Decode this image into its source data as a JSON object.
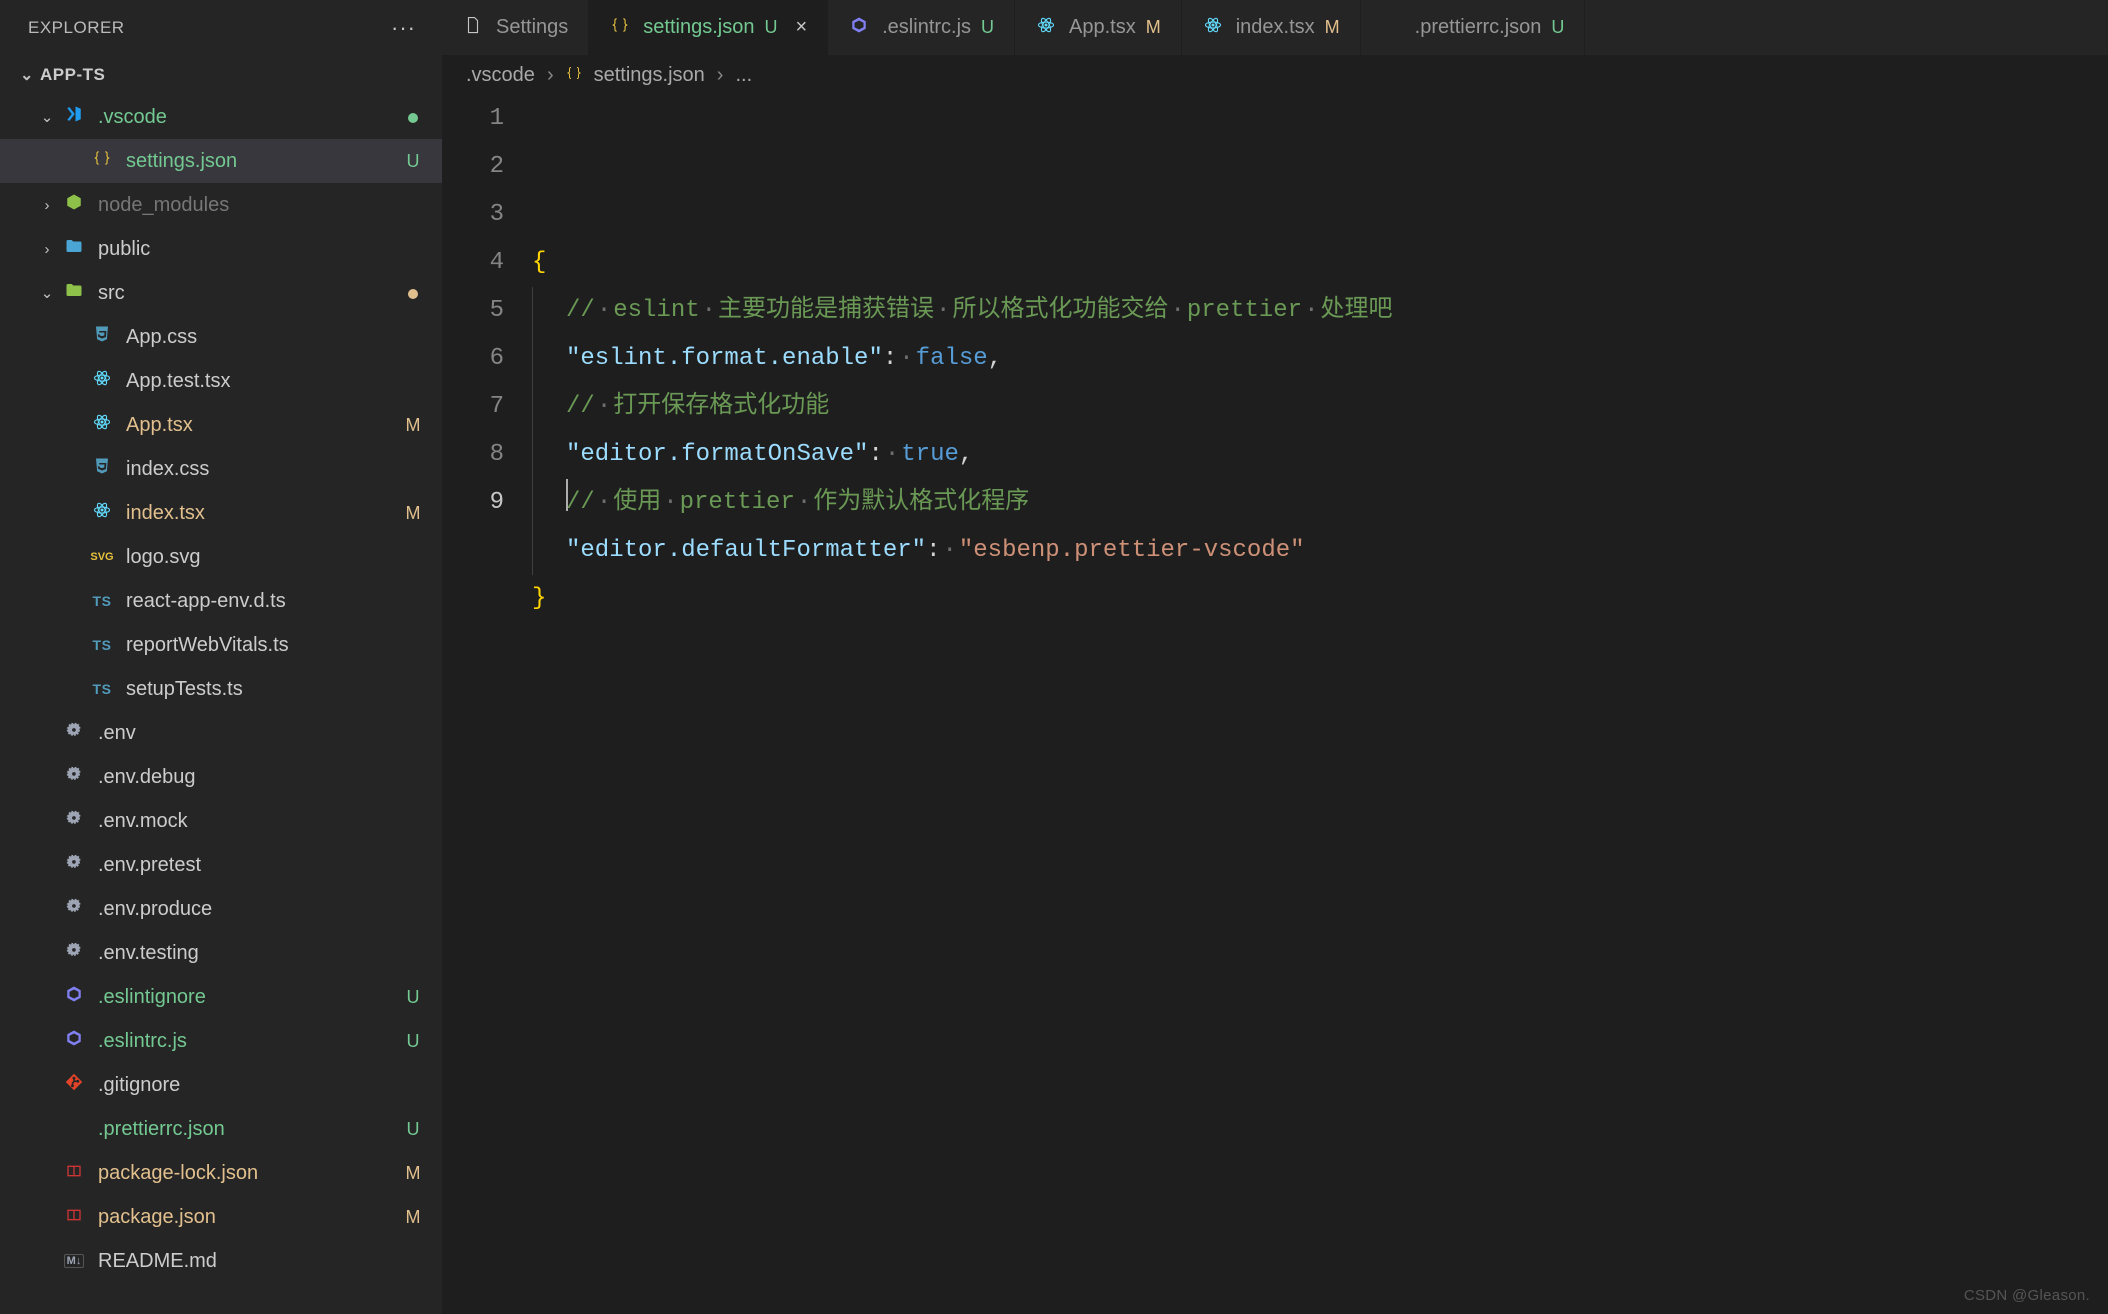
{
  "sidebar": {
    "header_title": "EXPLORER",
    "section_title": "APP-TS"
  },
  "tree": [
    {
      "kind": "folder",
      "name": ".vscode",
      "depth": 0,
      "expanded": true,
      "icon": "vscode",
      "status": "dot-green",
      "cls": "c-green"
    },
    {
      "kind": "file",
      "name": "settings.json",
      "depth": 1,
      "icon": "json",
      "status": "U",
      "cls": "c-green",
      "selected": true
    },
    {
      "kind": "folder",
      "name": "node_modules",
      "depth": 0,
      "expanded": false,
      "icon": "nodemod",
      "dim": true
    },
    {
      "kind": "folder",
      "name": "public",
      "depth": 0,
      "expanded": false,
      "icon": "public"
    },
    {
      "kind": "folder",
      "name": "src",
      "depth": 0,
      "expanded": true,
      "icon": "src",
      "status": "dot-yellow"
    },
    {
      "kind": "file",
      "name": "App.css",
      "depth": 1,
      "icon": "css"
    },
    {
      "kind": "file",
      "name": "App.test.tsx",
      "depth": 1,
      "icon": "react"
    },
    {
      "kind": "file",
      "name": "App.tsx",
      "depth": 1,
      "icon": "react",
      "status": "M",
      "cls": "c-yellow"
    },
    {
      "kind": "file",
      "name": "index.css",
      "depth": 1,
      "icon": "css"
    },
    {
      "kind": "file",
      "name": "index.tsx",
      "depth": 1,
      "icon": "react",
      "status": "M",
      "cls": "c-yellow"
    },
    {
      "kind": "file",
      "name": "logo.svg",
      "depth": 1,
      "icon": "svg"
    },
    {
      "kind": "file",
      "name": "react-app-env.d.ts",
      "depth": 1,
      "icon": "ts"
    },
    {
      "kind": "file",
      "name": "reportWebVitals.ts",
      "depth": 1,
      "icon": "ts"
    },
    {
      "kind": "file",
      "name": "setupTests.ts",
      "depth": 1,
      "icon": "ts"
    },
    {
      "kind": "file",
      "name": ".env",
      "depth": 0,
      "icon": "gear"
    },
    {
      "kind": "file",
      "name": ".env.debug",
      "depth": 0,
      "icon": "gear"
    },
    {
      "kind": "file",
      "name": ".env.mock",
      "depth": 0,
      "icon": "gear"
    },
    {
      "kind": "file",
      "name": ".env.pretest",
      "depth": 0,
      "icon": "gear"
    },
    {
      "kind": "file",
      "name": ".env.produce",
      "depth": 0,
      "icon": "gear"
    },
    {
      "kind": "file",
      "name": ".env.testing",
      "depth": 0,
      "icon": "gear"
    },
    {
      "kind": "file",
      "name": ".eslintignore",
      "depth": 0,
      "icon": "eslint",
      "status": "U",
      "cls": "c-green"
    },
    {
      "kind": "file",
      "name": ".eslintrc.js",
      "depth": 0,
      "icon": "eslint",
      "status": "U",
      "cls": "c-green"
    },
    {
      "kind": "file",
      "name": ".gitignore",
      "depth": 0,
      "icon": "git"
    },
    {
      "kind": "file",
      "name": ".prettierrc.json",
      "depth": 0,
      "icon": "prettier",
      "status": "U",
      "cls": "c-green"
    },
    {
      "kind": "file",
      "name": "package-lock.json",
      "depth": 0,
      "icon": "jsonpkg",
      "status": "M",
      "cls": "c-yellow"
    },
    {
      "kind": "file",
      "name": "package.json",
      "depth": 0,
      "icon": "jsonpkg",
      "status": "M",
      "cls": "c-yellow"
    },
    {
      "kind": "file",
      "name": "README.md",
      "depth": 0,
      "icon": "md"
    }
  ],
  "tabs": [
    {
      "label": "Settings",
      "icon": "fileblank"
    },
    {
      "label": "settings.json",
      "icon": "json",
      "suffix": "U",
      "active": true,
      "closable": true,
      "cls": "c-green"
    },
    {
      "label": ".eslintrc.js",
      "icon": "eslint",
      "suffix": "U"
    },
    {
      "label": "App.tsx",
      "icon": "react",
      "suffix": "M"
    },
    {
      "label": "index.tsx",
      "icon": "react",
      "suffix": "M"
    },
    {
      "label": ".prettierrc.json",
      "icon": "prettier",
      "suffix": "U"
    }
  ],
  "breadcrumb": {
    "seg0": ".vscode",
    "seg1": "settings.json",
    "tail": "..."
  },
  "code": {
    "lines": [
      [
        {
          "t": "brace",
          "v": "{"
        }
      ],
      [
        "indent",
        {
          "t": "comment",
          "parts": [
            "//",
            "eslint",
            "主要功能是捕获错误",
            "所以格式化功能交给",
            "prettier",
            "处理吧"
          ]
        }
      ],
      [
        "indent",
        {
          "t": "key",
          "v": "\"eslint.format.enable\""
        },
        {
          "t": "punc",
          "v": ":"
        },
        "sp",
        {
          "t": "bool",
          "v": "false"
        },
        {
          "t": "punc",
          "v": ","
        }
      ],
      [
        "indent",
        {
          "t": "comment",
          "parts": [
            "//",
            "打开保存格式化功能"
          ]
        }
      ],
      [
        "indent",
        {
          "t": "key",
          "v": "\"editor.formatOnSave\""
        },
        {
          "t": "punc",
          "v": ":"
        },
        "sp",
        {
          "t": "bool",
          "v": "true"
        },
        {
          "t": "punc",
          "v": ","
        }
      ],
      [
        "indent",
        {
          "t": "comment",
          "parts": [
            "//",
            "使用",
            "prettier",
            "作为默认格式化程序"
          ]
        }
      ],
      [
        "indent",
        {
          "t": "key",
          "v": "\"editor.defaultFormatter\""
        },
        {
          "t": "punc",
          "v": ":"
        },
        "sp",
        {
          "t": "str",
          "v": "\"esbenp.prettier-vscode\""
        }
      ],
      [
        {
          "t": "brace",
          "v": "}"
        }
      ],
      []
    ],
    "line_count": 9
  },
  "watermark": "CSDN @Gleason."
}
